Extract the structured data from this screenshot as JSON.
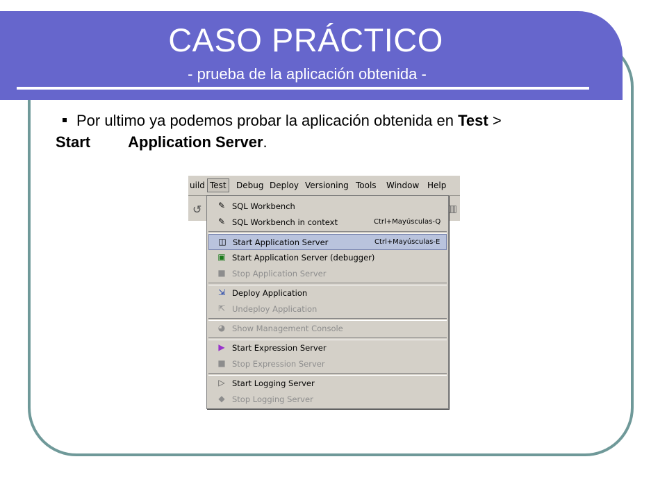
{
  "slide": {
    "title": "CASO PRÁCTICO",
    "subtitle": "- prueba de la aplicación obtenida -",
    "text_pre": "Por ultimo ya podemos probar la aplicación obtenida en ",
    "text_test": "Test",
    "text_gt": " >",
    "text_start": "Start",
    "text_server": "Application Server",
    "text_end": "."
  },
  "menubar": [
    "uild",
    "Test",
    "Debug",
    "Deploy",
    "Versioning",
    "Tools",
    "Window",
    "Help"
  ],
  "menu": {
    "items": [
      {
        "label": "SQL Workbench",
        "shortcut": "",
        "icon": "pencil-icon"
      },
      {
        "label": "SQL Workbench in context",
        "shortcut": "Ctrl+Mayúsculas-Q",
        "icon": "pencil-icon"
      },
      {
        "label": "Start Application Server",
        "shortcut": "Ctrl+Mayúsculas-E",
        "icon": "server-start-icon"
      },
      {
        "label": "Start Application Server (debugger)",
        "shortcut": "",
        "icon": "debug-server-icon"
      },
      {
        "label": "Stop Application Server",
        "shortcut": "",
        "icon": "stop-icon"
      },
      {
        "label": "Deploy Application",
        "shortcut": "",
        "icon": "deploy-icon"
      },
      {
        "label": "Undeploy Application",
        "shortcut": "",
        "icon": "undeploy-icon"
      },
      {
        "label": "Show Management Console",
        "shortcut": "",
        "icon": "console-icon"
      },
      {
        "label": "Start Expression Server",
        "shortcut": "",
        "icon": "expression-icon"
      },
      {
        "label": "Stop Expression Server",
        "shortcut": "",
        "icon": "stop-icon"
      },
      {
        "label": "Start Logging Server",
        "shortcut": "",
        "icon": "play-icon"
      },
      {
        "label": "Stop Logging Server",
        "shortcut": "",
        "icon": "diamond-icon"
      }
    ]
  },
  "colors": {
    "title_band": "#6666cc",
    "frame": "#6f9999",
    "highlight": "#b9c3dd"
  }
}
